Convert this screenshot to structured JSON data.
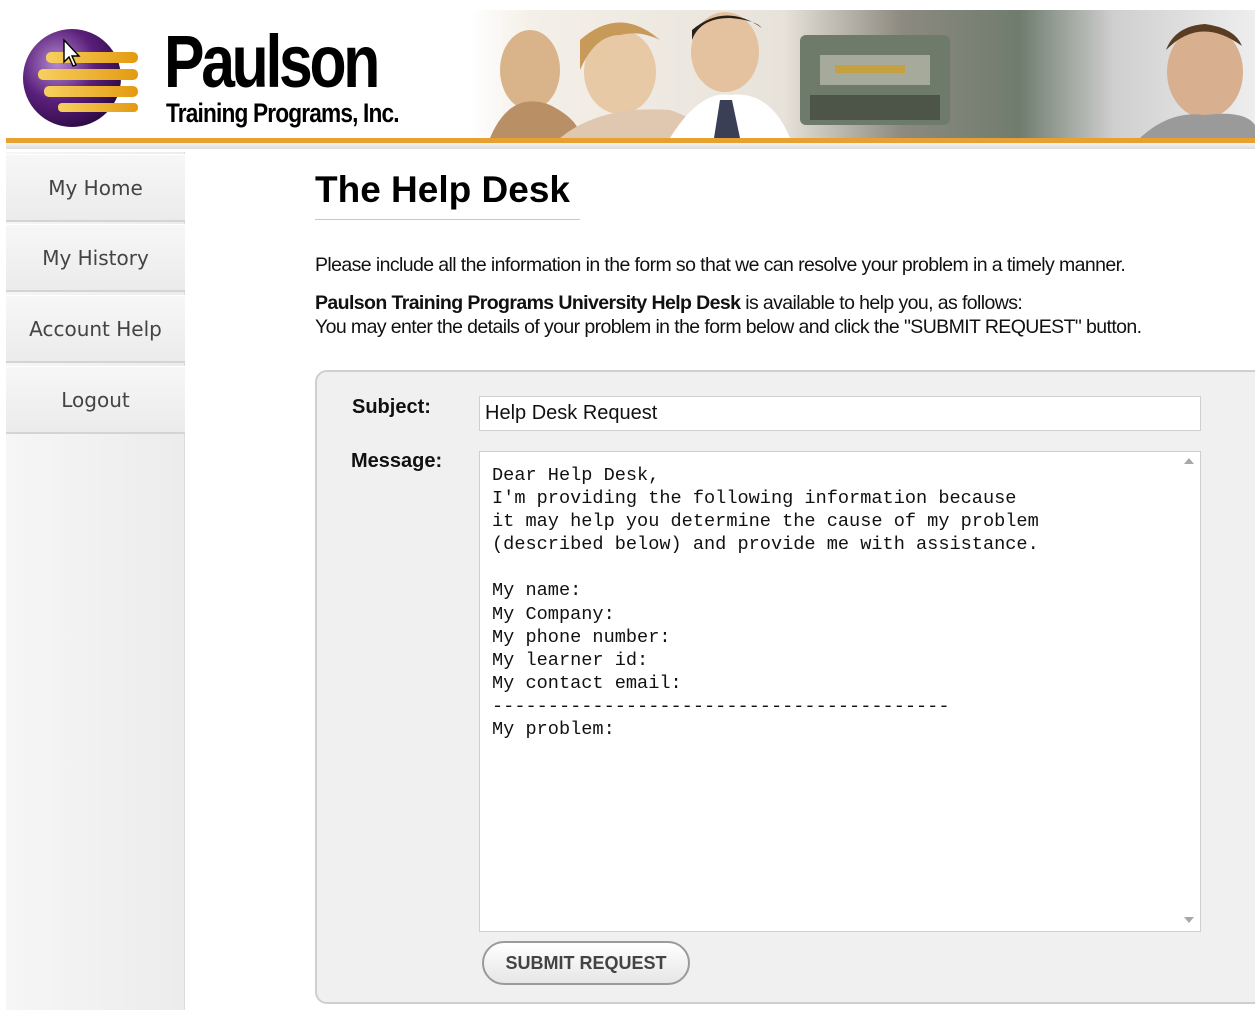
{
  "header": {
    "brand_name": "Paulson",
    "brand_sub": "Training Programs, Inc."
  },
  "sidebar": {
    "items": [
      {
        "label": "My Home"
      },
      {
        "label": "My History"
      },
      {
        "label": "Account Help"
      },
      {
        "label": "Logout"
      }
    ]
  },
  "main": {
    "title": "The Help Desk",
    "intro": "Please include all the information in the form so that we can resolve your problem in a timely manner.",
    "availability_bold": "Paulson Training Programs University Help Desk",
    "availability_rest": " is available to help you, as follows:",
    "instructions": "You may enter the details of your problem in the form below and click the \"SUBMIT REQUEST\" button."
  },
  "form": {
    "subject_label": "Subject:",
    "subject_value": "Help Desk Request",
    "message_label": "Message:",
    "message_value": "Dear Help Desk,\nI'm providing the following information because\nit may help you determine the cause of my problem\n(described below) and provide me with assistance.\n\nMy name:\nMy Company:\nMy phone number:\nMy learner id:\nMy contact email:\n-----------------------------------------\nMy problem:",
    "submit_label": "SUBMIT REQUEST"
  },
  "colors": {
    "accent_orange": "#e8a030",
    "logo_purple": "#5a1f7a",
    "logo_gold": "#f0b020"
  }
}
